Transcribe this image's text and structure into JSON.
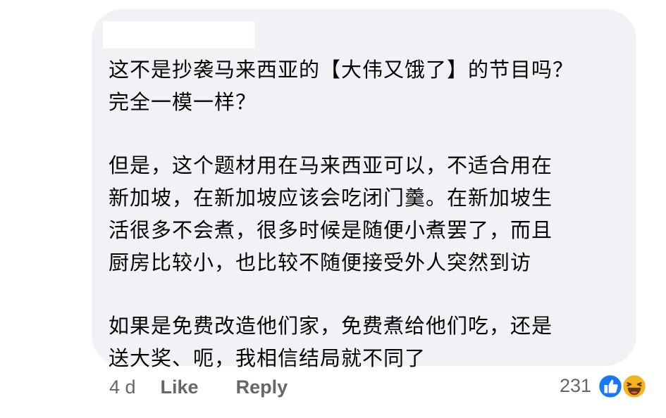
{
  "comment": {
    "paragraphs": [
      "这不是抄袭马来西亚的【大伟又饿了】的节目吗？\n完全一模一样？",
      "但是，这个题材用在马来西亚可以，不适合用在\n新加坡，在新加坡应该会吃闭门羹。在新加坡生\n活很多不会煮，很多时候是随便小煮罢了，而且\n厨房比较小，也比较不随便接受外人突然到访",
      "如果是免费改造他们家，免费煮给他们吃，还是\n送大奖、呃，我相信结局就不同了"
    ],
    "timestamp": "4 d",
    "like_label": "Like",
    "reply_label": "Reply",
    "reaction_count": "231",
    "reactions": [
      "like-icon",
      "haha-icon"
    ]
  },
  "colors": {
    "bubble_background": "#f0f2f5",
    "text": "#050505",
    "meta_text": "#65676b",
    "like_blue": "#1877f2",
    "haha_yellow": "#f7b125"
  }
}
